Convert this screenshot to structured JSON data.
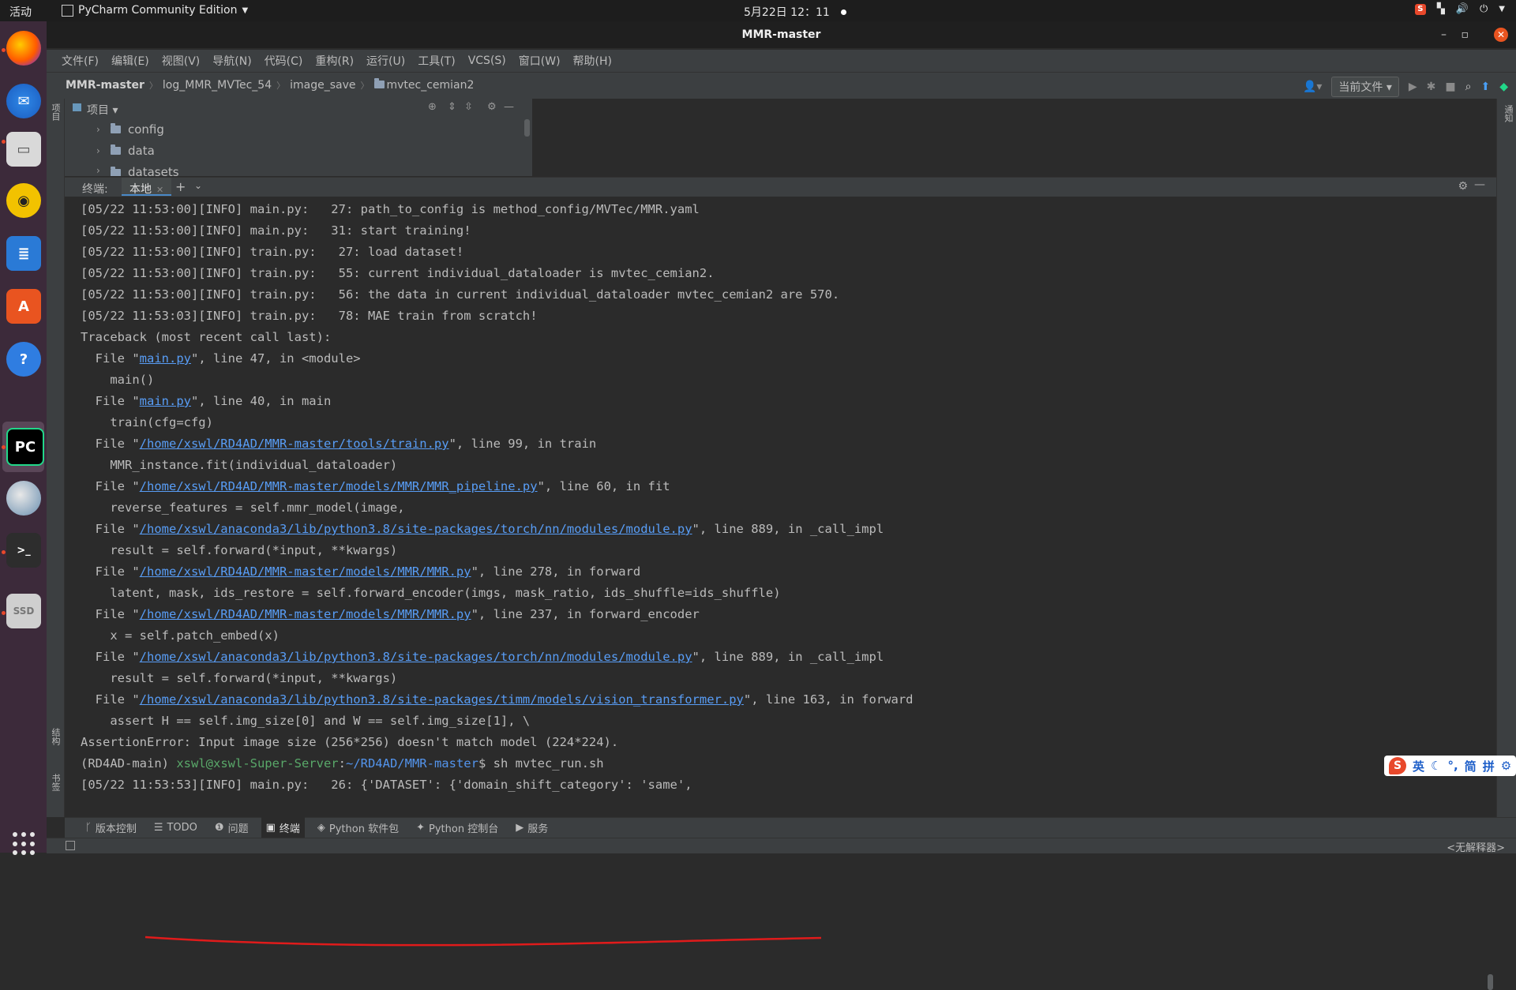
{
  "topbar": {
    "activities": "活动",
    "app_menu": "PyCharm Community Edition",
    "clock": "5月22日  12：11"
  },
  "window": {
    "title": "MMR-master"
  },
  "menu": [
    "文件(F)",
    "编辑(E)",
    "视图(V)",
    "导航(N)",
    "代码(C)",
    "重构(R)",
    "运行(U)",
    "工具(T)",
    "VCS(S)",
    "窗口(W)",
    "帮助(H)"
  ],
  "breadcrumb": {
    "root": "MMR-master",
    "items": [
      "log_MMR_MVTec_54",
      "image_save",
      "mvtec_cemian2"
    ]
  },
  "run_config": "当前文件",
  "left_strip": {
    "project": "项目",
    "structure": "结构",
    "bookmarks": "书签"
  },
  "right_strip": {
    "notifications": "通知"
  },
  "project_panel": {
    "title": "项目",
    "tree": [
      "config",
      "data",
      "datasets"
    ]
  },
  "terminal": {
    "label": "终端:",
    "tab": "本地",
    "lines": [
      [
        {
          "t": "[05/22 11:53:00][INFO] main.py:   27: path_to_config is method_config/MVTec/MMR.yaml"
        }
      ],
      [
        {
          "t": "[05/22 11:53:00][INFO] main.py:   31: start training!"
        }
      ],
      [
        {
          "t": "[05/22 11:53:00][INFO] train.py:   27: load dataset!"
        }
      ],
      [
        {
          "t": "[05/22 11:53:00][INFO] train.py:   55: current individual_dataloader is mvtec_cemian2."
        }
      ],
      [
        {
          "t": "[05/22 11:53:00][INFO] train.py:   56: the data in current individual_dataloader mvtec_cemian2 are 570."
        }
      ],
      [
        {
          "t": "[05/22 11:53:03][INFO] train.py:   78: MAE train from scratch!"
        }
      ],
      [
        {
          "t": "Traceback (most recent call last):"
        }
      ],
      [
        {
          "t": "  File \""
        },
        {
          "t": "main.py",
          "c": "link"
        },
        {
          "t": "\", line 47, in <module>"
        }
      ],
      [
        {
          "t": "    main()"
        }
      ],
      [
        {
          "t": "  File \""
        },
        {
          "t": "main.py",
          "c": "link"
        },
        {
          "t": "\", line 40, in main"
        }
      ],
      [
        {
          "t": "    train(cfg=cfg)"
        }
      ],
      [
        {
          "t": "  File \""
        },
        {
          "t": "/home/xswl/RD4AD/MMR-master/tools/train.py",
          "c": "link"
        },
        {
          "t": "\", line 99, in train"
        }
      ],
      [
        {
          "t": "    MMR_instance.fit(individual_dataloader)"
        }
      ],
      [
        {
          "t": "  File \""
        },
        {
          "t": "/home/xswl/RD4AD/MMR-master/models/MMR/MMR_pipeline.py",
          "c": "link"
        },
        {
          "t": "\", line 60, in fit"
        }
      ],
      [
        {
          "t": "    reverse_features = self.mmr_model(image,"
        }
      ],
      [
        {
          "t": "  File \""
        },
        {
          "t": "/home/xswl/anaconda3/lib/python3.8/site-packages/torch/nn/modules/module.py",
          "c": "link"
        },
        {
          "t": "\", line 889, in _call_impl"
        }
      ],
      [
        {
          "t": "    result = self.forward(*input, **kwargs)"
        }
      ],
      [
        {
          "t": "  File \""
        },
        {
          "t": "/home/xswl/RD4AD/MMR-master/models/MMR/MMR.py",
          "c": "link"
        },
        {
          "t": "\", line 278, in forward"
        }
      ],
      [
        {
          "t": "    latent, mask, ids_restore = self.forward_encoder(imgs, mask_ratio, ids_shuffle=ids_shuffle)"
        }
      ],
      [
        {
          "t": "  File \""
        },
        {
          "t": "/home/xswl/RD4AD/MMR-master/models/MMR/MMR.py",
          "c": "link"
        },
        {
          "t": "\", line 237, in forward_encoder"
        }
      ],
      [
        {
          "t": "    x = self.patch_embed(x)"
        }
      ],
      [
        {
          "t": "  File \""
        },
        {
          "t": "/home/xswl/anaconda3/lib/python3.8/site-packages/torch/nn/modules/module.py",
          "c": "link"
        },
        {
          "t": "\", line 889, in _call_impl"
        }
      ],
      [
        {
          "t": "    result = self.forward(*input, **kwargs)"
        }
      ],
      [
        {
          "t": "  File \""
        },
        {
          "t": "/home/xswl/anaconda3/lib/python3.8/site-packages/timm/models/vision_transformer.py",
          "c": "link"
        },
        {
          "t": "\", line 163, in forward"
        }
      ],
      [
        {
          "t": "    assert H == self.img_size[0] and W == self.img_size[1], \\"
        }
      ],
      [
        {
          "t": "AssertionError: Input image size (256*256) doesn't match model (224*224)."
        }
      ],
      [
        {
          "t": "(RD4AD-main) "
        },
        {
          "t": "xswl@xswl-Super-Server",
          "c": "grn"
        },
        {
          "t": ":"
        },
        {
          "t": "~/RD4AD/MMR-master",
          "c": "blu"
        },
        {
          "t": "$ sh mvtec_run.sh"
        }
      ],
      [
        {
          "t": "[05/22 11:53:53][INFO] main.py:   26: {'DATASET': {'domain_shift_category': 'same',"
        }
      ]
    ]
  },
  "ime": [
    "英",
    "简",
    "拼"
  ],
  "bottom_tabs": [
    "版本控制",
    "TODO",
    "问题",
    "终端",
    "Python 软件包",
    "Python 控制台",
    "服务"
  ],
  "active_bottom_tab": "终端",
  "status_right": "<无解释器>",
  "colors": {
    "link": "#589df6",
    "prompt_user": "#59a869",
    "prompt_path": "#5394ec",
    "annotation": "#e01b1b",
    "ubuntu_orange": "#e95420"
  },
  "dock_icons": [
    "firefox-icon",
    "thunderbird-icon",
    "files-icon",
    "rhythmbox-icon",
    "writer-icon",
    "software-icon",
    "help-icon",
    "pycharm-icon",
    "disc-icon",
    "terminal-icon",
    "ssd-icon"
  ]
}
